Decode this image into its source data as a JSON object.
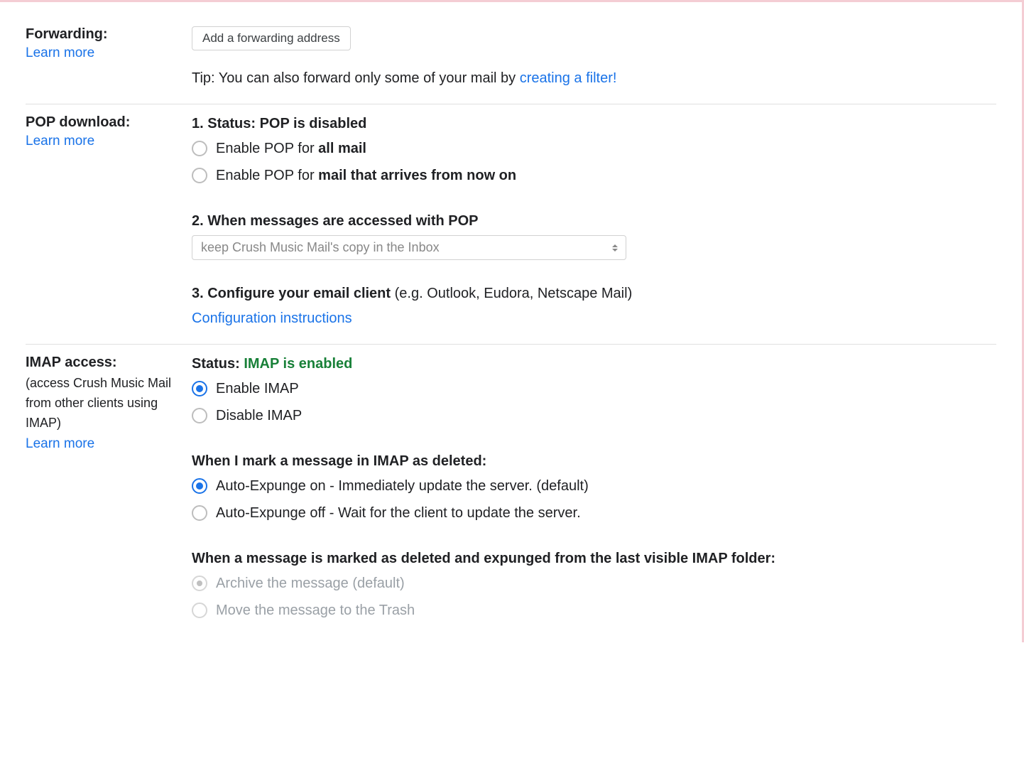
{
  "forwarding": {
    "title": "Forwarding:",
    "learn_more": "Learn more",
    "add_button": "Add a forwarding address",
    "tip_prefix": "Tip: You can also forward only some of your mail by ",
    "tip_link": "creating a filter!"
  },
  "pop": {
    "title": "POP download:",
    "learn_more": "Learn more",
    "status_line_prefix": "1. Status: ",
    "status_line_value": "POP is disabled",
    "opt_all_prefix": "Enable POP for ",
    "opt_all_bold": "all mail",
    "opt_now_prefix": "Enable POP for ",
    "opt_now_bold": "mail that arrives from now on",
    "step2": "2. When messages are accessed with POP",
    "select_value": "keep Crush Music Mail's copy in the Inbox",
    "step3_bold": "3. Configure your email client ",
    "step3_rest": "(e.g. Outlook, Eudora, Netscape Mail)",
    "config_link": "Configuration instructions"
  },
  "imap": {
    "title": "IMAP access:",
    "subtitle": "(access Crush Music Mail from other clients using IMAP)",
    "learn_more": "Learn more",
    "status_prefix": "Status: ",
    "status_value": "IMAP is enabled",
    "enable": "Enable IMAP",
    "disable": "Disable IMAP",
    "deleted_heading": "When I mark a message in IMAP as deleted:",
    "expunge_on": "Auto-Expunge on - Immediately update the server. (default)",
    "expunge_off": "Auto-Expunge off - Wait for the client to update the server.",
    "expunged_heading": "When a message is marked as deleted and expunged from the last visible IMAP folder:",
    "archive": "Archive the message (default)",
    "trash": "Move the message to the Trash"
  }
}
